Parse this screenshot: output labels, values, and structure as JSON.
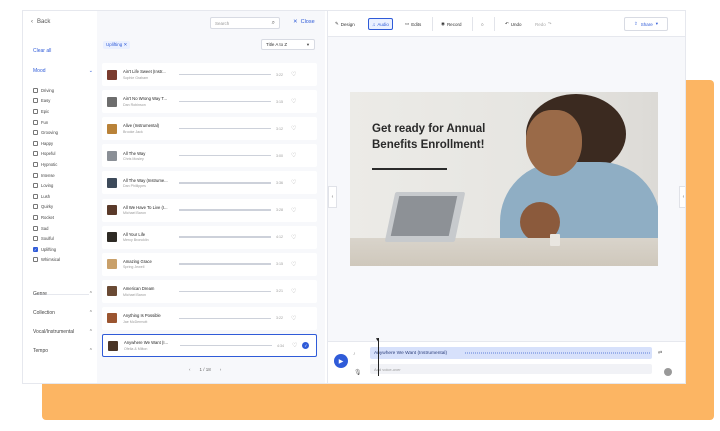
{
  "filters": {
    "back": "Back",
    "clear_all": "Clear all",
    "mood_heading": "Mood",
    "mood_items": [
      {
        "label": "Driving",
        "checked": false
      },
      {
        "label": "Easy",
        "checked": false
      },
      {
        "label": "Epic",
        "checked": false
      },
      {
        "label": "Fun",
        "checked": false
      },
      {
        "label": "Grooving",
        "checked": false
      },
      {
        "label": "Happy",
        "checked": false
      },
      {
        "label": "Hopeful",
        "checked": false
      },
      {
        "label": "Hypnotic",
        "checked": false
      },
      {
        "label": "Intense",
        "checked": false
      },
      {
        "label": "Loving",
        "checked": false
      },
      {
        "label": "Lush",
        "checked": false
      },
      {
        "label": "Quirky",
        "checked": false
      },
      {
        "label": "Rocket",
        "checked": false
      },
      {
        "label": "Sad",
        "checked": false
      },
      {
        "label": "Soulful",
        "checked": false
      },
      {
        "label": "Uplifting",
        "checked": true
      },
      {
        "label": "Whimsical",
        "checked": false
      }
    ],
    "other_groups": [
      "Genre",
      "Collection",
      "Vocal/Instrumental",
      "Tempo"
    ]
  },
  "tracks": {
    "search_placeholder": "Search",
    "close_label": "Close",
    "active_chip": "Uplifting ✕",
    "sort_label": "Title A to Z",
    "items": [
      {
        "title": "Ain't Life Sweet (Instr...",
        "artist": "Sophie Graham",
        "duration": "3:22",
        "color": "#7a3b2e"
      },
      {
        "title": "Ain't No Wrong Way T...",
        "artist": "Dan Robinson",
        "duration": "3:15",
        "color": "#6d6d6d"
      },
      {
        "title": "Alive (Instrumental)",
        "artist": "Brooke Jack",
        "duration": "3:12",
        "color": "#b98238"
      },
      {
        "title": "All The Way",
        "artist": "Chris Mosley",
        "duration": "3:00",
        "color": "#8a8f96"
      },
      {
        "title": "All The Way (Instrume...",
        "artist": "Dan Phillippes",
        "duration": "3:36",
        "color": "#3d4a5a"
      },
      {
        "title": "All We Have To Live (I...",
        "artist": "Michael Baron",
        "duration": "3:28",
        "color": "#5a3a2a"
      },
      {
        "title": "All Your Life",
        "artist": "Mercy Broncklin",
        "duration": "4:12",
        "color": "#2e2a24"
      },
      {
        "title": "Amazing Grace",
        "artist": "Spring Jewell",
        "duration": "3:15",
        "color": "#c9a06a"
      },
      {
        "title": "American Dream",
        "artist": "Michael Baron",
        "duration": "3:21",
        "color": "#6a4a34"
      },
      {
        "title": "Anything Is Possible",
        "artist": "Jae McDermott",
        "duration": "3:22",
        "color": "#9b5530"
      },
      {
        "title": "Anywhere We Want (I...",
        "artist": "Ofelia & Milton",
        "duration": "4:34",
        "color": "#4a3526"
      }
    ],
    "pager": {
      "prev": "‹",
      "current": "1 / 18",
      "next": "›"
    }
  },
  "toolbar": {
    "design": "Design",
    "audio": "Audio",
    "edits": "Edits",
    "record": "Record",
    "undo": "Undo",
    "redo": "Redo",
    "share": "Share"
  },
  "canvas": {
    "headline": "Get ready for Annual Benefits Enrollment!"
  },
  "timeline": {
    "audio_track": "Anywhere We Want (Instrumental)",
    "vo_placeholder": "Add voice-over"
  },
  "colors": {
    "accent": "#2f5bd8",
    "backdrop": "#fcb563"
  }
}
